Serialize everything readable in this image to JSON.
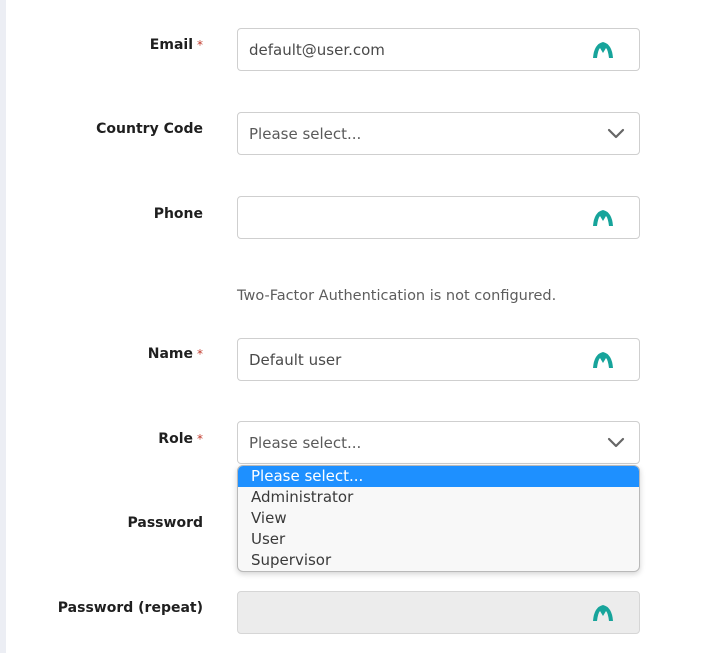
{
  "form": {
    "email": {
      "label": "Email",
      "required_mark": "*",
      "value": "default@user.com"
    },
    "country_code": {
      "label": "Country Code",
      "placeholder": "Please select..."
    },
    "phone": {
      "label": "Phone",
      "value": ""
    },
    "two_factor_note": "Two-Factor Authentication is not configured.",
    "name": {
      "label": "Name",
      "required_mark": "*",
      "value": "Default user"
    },
    "role": {
      "label": "Role",
      "required_mark": "*",
      "placeholder": "Please select...",
      "options": [
        "Please select...",
        "Administrator",
        "View",
        "User",
        "Supervisor"
      ],
      "highlighted_option": "Please select..."
    },
    "password": {
      "label": "Password"
    },
    "password_repeat": {
      "label": "Password (repeat)"
    }
  },
  "icons": {
    "field_autofill": "password-manager-icon",
    "select_arrow": "chevron-down-icon"
  },
  "colors": {
    "icon_teal": "#17a49b",
    "selected_option_bg": "#1e90ff",
    "required_mark": "#c0392b",
    "disabled_field_bg": "#ececec"
  }
}
